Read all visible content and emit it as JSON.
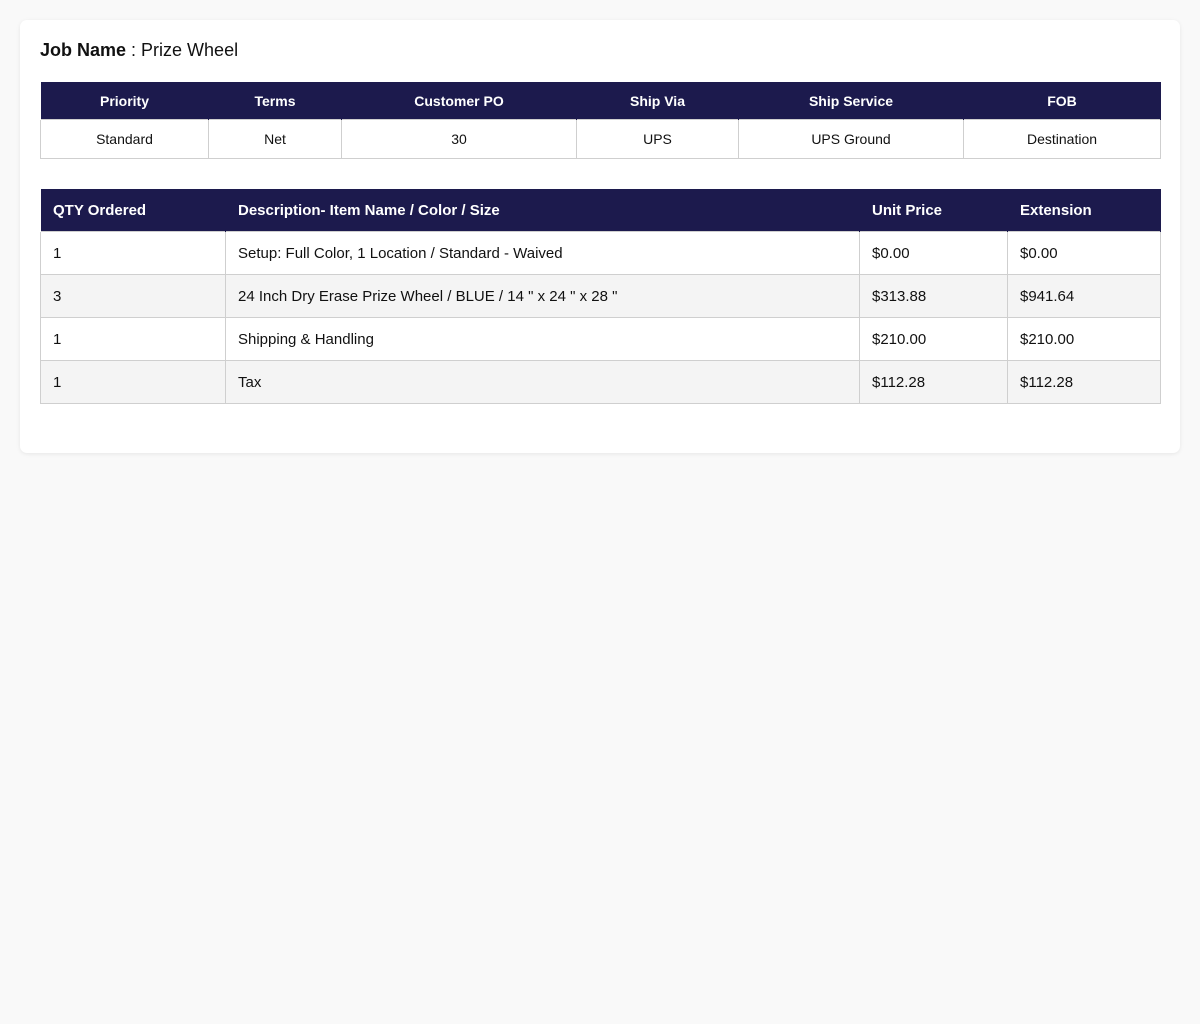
{
  "theme": {
    "header_bg": "#1c1a4d",
    "header_text": "#ffffff",
    "row_alt_bg": "#f4f4f4",
    "border": "#cfcfcf"
  },
  "job": {
    "label": "Job Name",
    "separator": " : ",
    "value": "Prize Wheel"
  },
  "meta": {
    "headers": [
      "Priority",
      "Terms",
      "Customer PO",
      "Ship Via",
      "Ship Service",
      "FOB"
    ],
    "values": [
      "Standard",
      "Net",
      "30",
      "UPS",
      "UPS Ground",
      "Destination"
    ]
  },
  "items": {
    "headers": [
      "QTY Ordered",
      "Description- Item Name / Color / Size",
      "Unit Price",
      "Extension"
    ],
    "rows": [
      [
        "1",
        "Setup: Full Color, 1 Location / Standard - Waived",
        "$0.00",
        "$0.00"
      ],
      [
        "3",
        "24 Inch Dry Erase Prize Wheel / BLUE / 14 \" x 24 \" x 28 \"",
        "$313.88",
        "$941.64"
      ],
      [
        "1",
        "Shipping & Handling",
        "$210.00",
        "$210.00"
      ],
      [
        "1",
        "Tax",
        "$112.28",
        "$112.28"
      ]
    ]
  }
}
